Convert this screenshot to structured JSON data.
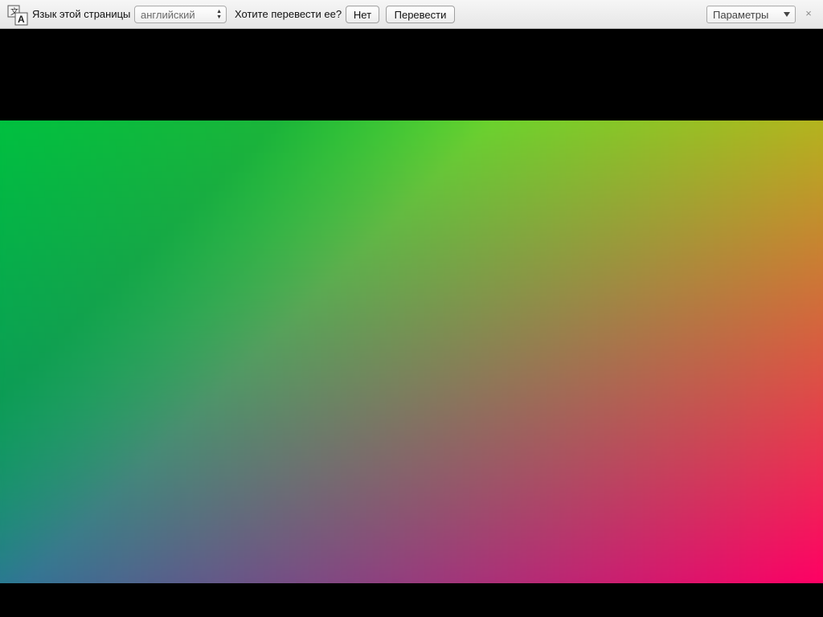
{
  "translate_bar": {
    "language_label": "Язык этой страницы",
    "language_value": "английский",
    "question": "Хотите перевести ее?",
    "no_button": "Нет",
    "translate_button": "Перевести",
    "options_value": "Параметры",
    "close_glyph": "×",
    "translate_icon": "translate-icon"
  },
  "content": {
    "gradient_colors": {
      "top_left": "#00ff44",
      "top_right": "#b4b41e",
      "bottom_left": "#2d7896",
      "bottom_right": "#ff0064",
      "band_color": "#00b04a"
    }
  }
}
